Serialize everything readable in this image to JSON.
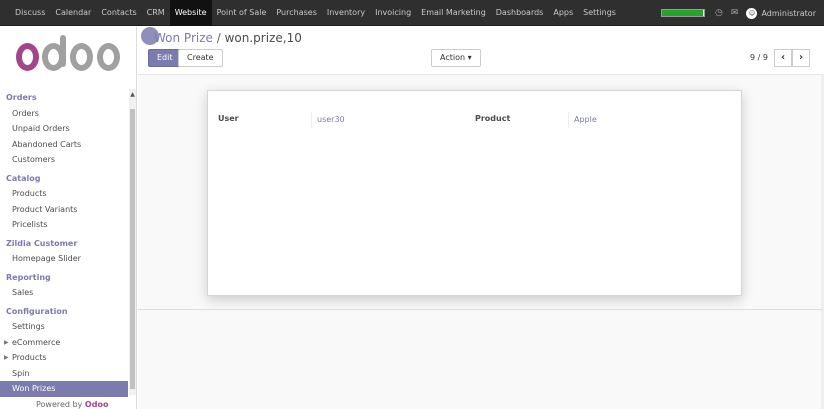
{
  "topbar": {
    "menu": [
      "Discuss",
      "Calendar",
      "Contacts",
      "CRM",
      "Website",
      "Point of Sale",
      "Purchases",
      "Inventory",
      "Invoicing",
      "Email Marketing",
      "Dashboards",
      "Apps",
      "Settings"
    ],
    "active": "Website",
    "user_name": "Administrator",
    "progress": 0.97
  },
  "sidebar": {
    "sections": [
      {
        "title": "Orders",
        "items": [
          "Orders",
          "Unpaid Orders",
          "Abandoned Carts",
          "Customers"
        ]
      },
      {
        "title": "Catalog",
        "items": [
          "Products",
          "Product Variants",
          "Pricelists"
        ]
      },
      {
        "title": "Zildia Customer",
        "items": [
          "Homepage Slider"
        ]
      },
      {
        "title": "Reporting",
        "items": [
          "Sales"
        ]
      },
      {
        "title": "Configuration",
        "items": [
          "Settings",
          "eCommerce",
          "Products",
          "Spin",
          "Won Prizes"
        ]
      }
    ],
    "active_item": "Won Prizes",
    "powered_prefix": "Powered by",
    "powered_brand": "Odoo"
  },
  "breadcrumb": {
    "parent": "Won Prize",
    "separator": "/",
    "current": "won.prize,10"
  },
  "buttons": {
    "edit": "Edit",
    "create": "Create",
    "action": "Action ▾"
  },
  "pager": "9 / 9",
  "form": {
    "user_label": "User",
    "user_value": "user30",
    "product_label": "Product",
    "product_value": "Apple"
  },
  "colors": {
    "accent": "#7c7bad",
    "brand": "#a24689",
    "topbar": "#2f2f2f"
  }
}
